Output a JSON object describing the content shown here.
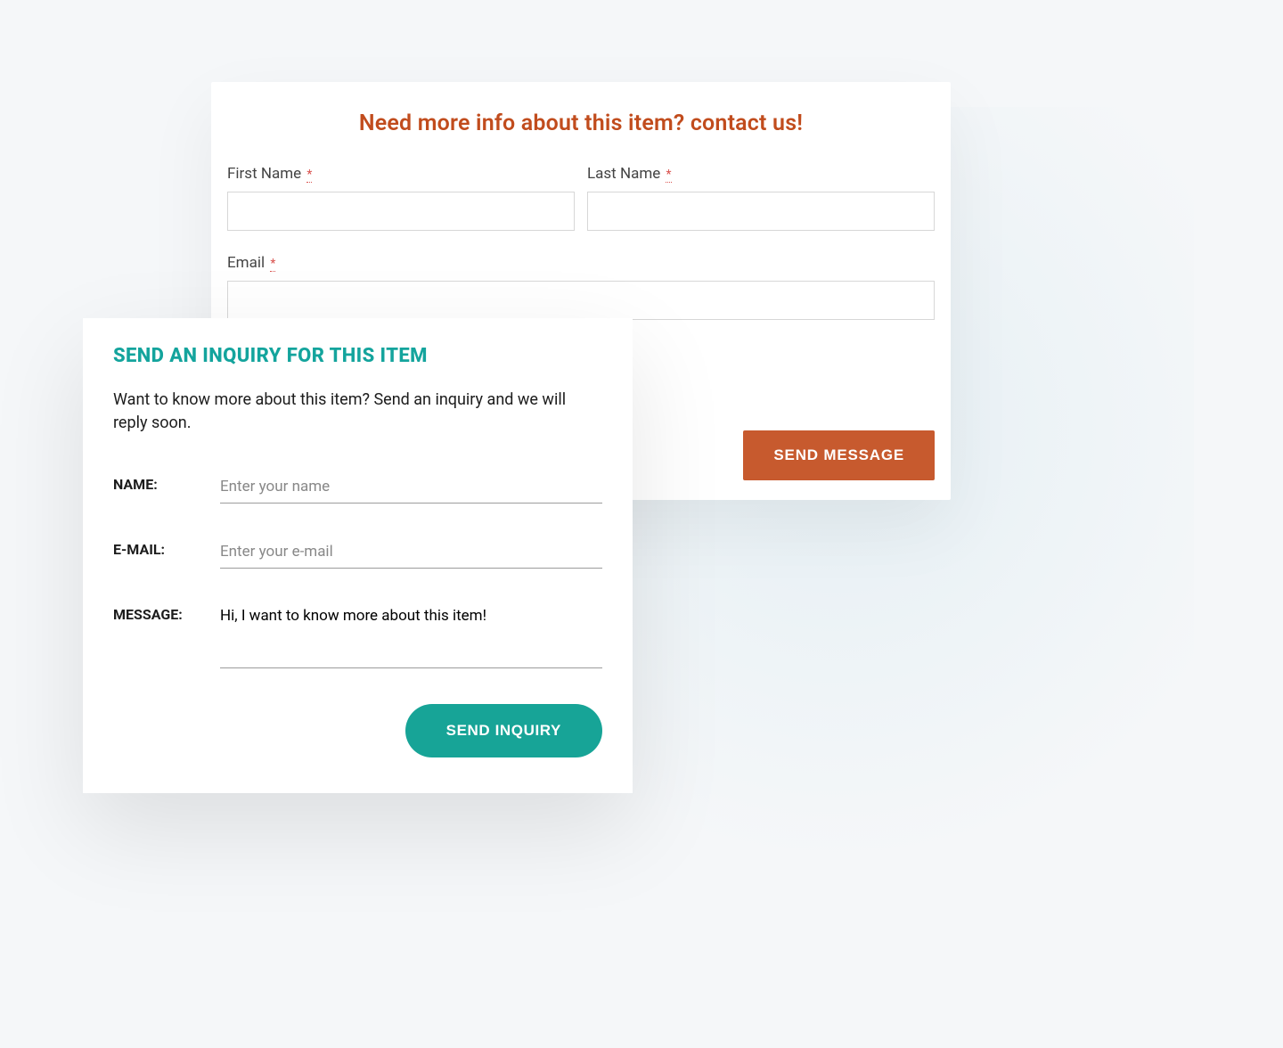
{
  "back_form": {
    "title": "Need more info about this item? contact us!",
    "first_name_label": "First Name",
    "last_name_label": "Last Name",
    "email_label": "Email",
    "required_mark": "*",
    "first_name_value": "",
    "last_name_value": "",
    "email_value": "",
    "message_value": "",
    "send_button": "SEND MESSAGE"
  },
  "front_form": {
    "title": "SEND AN INQUIRY FOR THIS ITEM",
    "description": "Want to know more about this item? Send an inquiry and we will reply soon.",
    "name_label": "NAME:",
    "name_placeholder": "Enter your name",
    "name_value": "",
    "email_label": "E-MAIL:",
    "email_placeholder": "Enter your e-mail",
    "email_value": "",
    "message_label": "MESSAGE:",
    "message_value": "Hi, I want to know more about this item!",
    "send_button": "SEND INQUIRY"
  },
  "colors": {
    "orange": "#c75a2e",
    "teal": "#17a497",
    "teal_title": "#14a49d",
    "bg": "#f5f7f9"
  }
}
